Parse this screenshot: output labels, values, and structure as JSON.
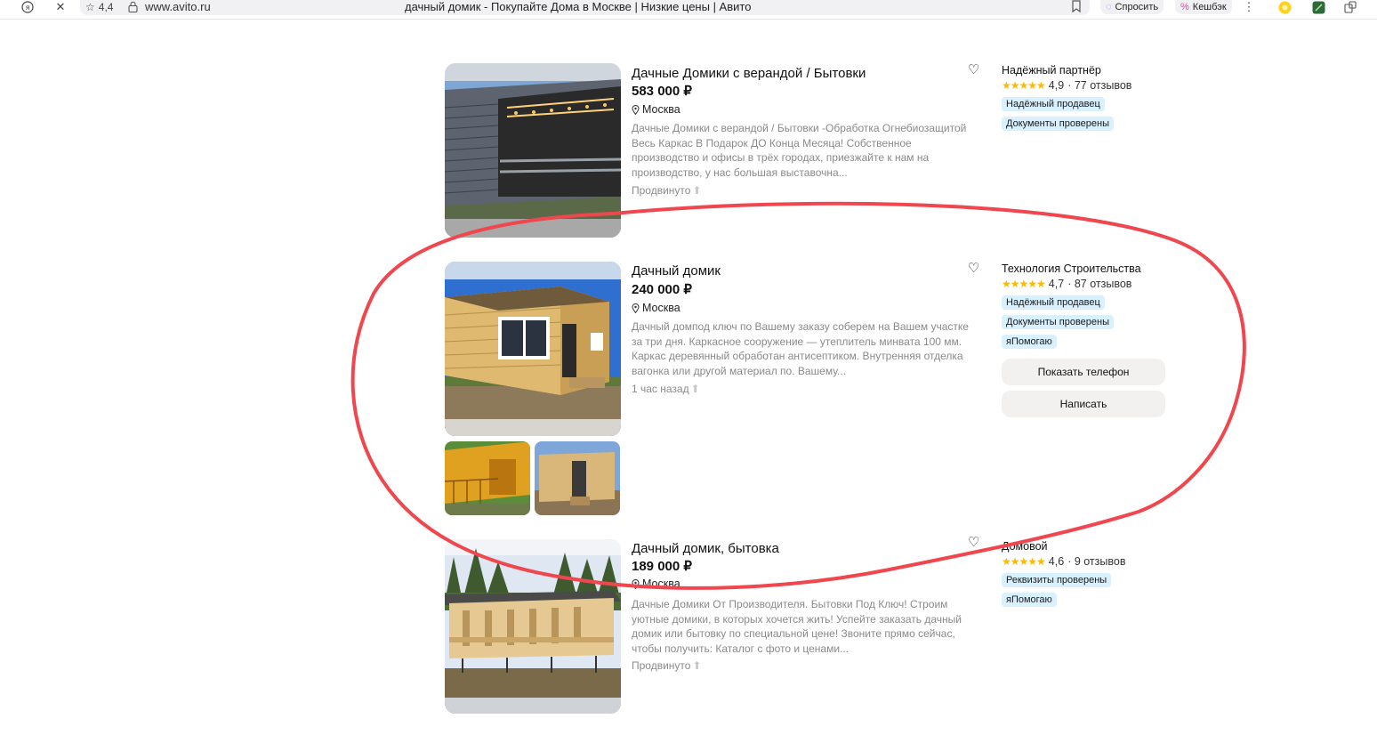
{
  "browser": {
    "rating": "4,4",
    "url": "www.avito.ru",
    "page_title": "дачный домик - Покупайте Дома в Москве | Низкие цены | Авито",
    "ask_label": "Спросить",
    "cashback_label": "Кешбэк"
  },
  "listings": [
    {
      "title": "Дачные Домики с верандой / Бытовки",
      "price": "583 000 ₽",
      "location": "Москва",
      "description": "Дачные Домики с верандой / Бытовки -Обработка Огнебиозащитой Весь Каркас В Подарок ДО Конца Месяца! Собственное производство и офисы в трёх городах, приезжайте к нам на производство, у нас большая выставочна...",
      "meta": "Продвинуто",
      "seller": {
        "name": "Надёжный партнёр",
        "rating": "4,9",
        "reviews": "· 77 отзывов",
        "badges": [
          "Надёжный продавец",
          "Документы проверены"
        ]
      }
    },
    {
      "title": "Дачный домик",
      "price": "240 000 ₽",
      "location": "Москва",
      "description": "Дачный домпод ключ по Вашему заказу соберем на Вашем участке за три дня. Каркасное сооружение — утеплитель минвата 100 мм. Каркас деревянный обработан антисептиком. Внутренняя отделка вагонка или другой материал по. Вашему...",
      "meta": "1 час назад",
      "seller": {
        "name": "Технология Строительства",
        "rating": "4,7",
        "reviews": "· 87 отзывов",
        "badges": [
          "Надёжный продавец",
          "Документы проверены",
          "яПомогаю"
        ],
        "show_phone": "Показать телефон",
        "write": "Написать"
      }
    },
    {
      "title": "Дачный домик, бытовка",
      "price": "189 000 ₽",
      "location": "Москва",
      "description": "Дачные Домики От Производителя. Бытовки Под Ключ! Строим уютные домики, в которых хочется жить! Успейте заказать дачный домик или бытовку по специальной цене! Звоните прямо сейчас, чтобы получить: Каталог с фото и ценами...",
      "meta": "Продвинуто",
      "seller": {
        "name": "Домовой",
        "rating": "4,6",
        "reviews": "· 9 отзывов",
        "badges": [
          "Реквизиты проверены",
          "яПомогаю"
        ]
      }
    }
  ],
  "colors": {
    "annotation": "#f0474f",
    "badge_bg": "#d9f0ff",
    "star": "#ffb800",
    "button_bg": "#f2f1f0"
  }
}
